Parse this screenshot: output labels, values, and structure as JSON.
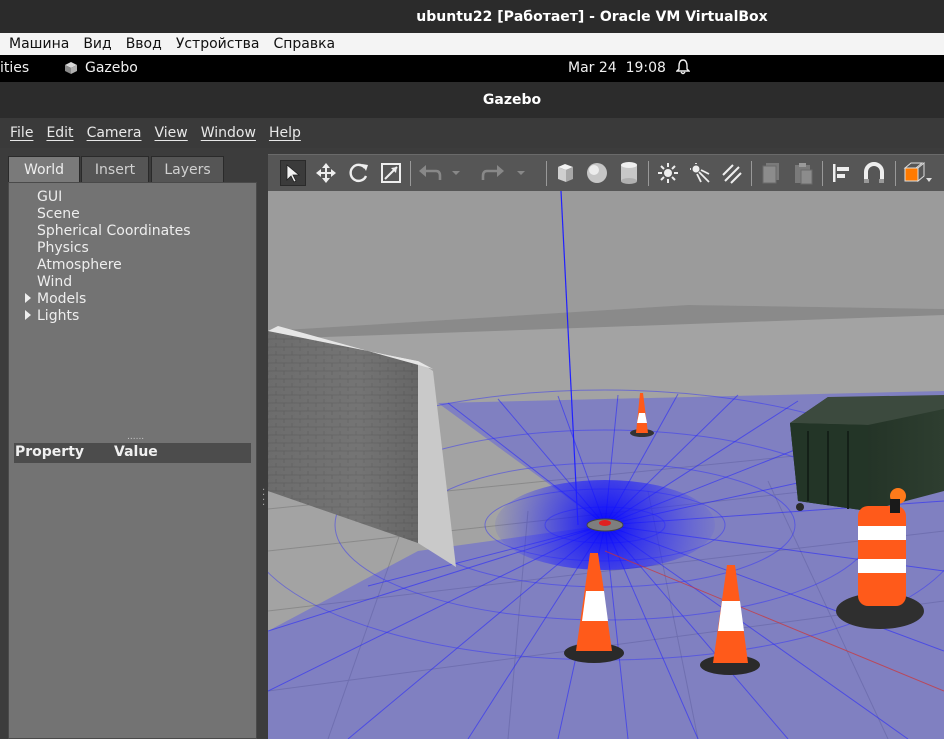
{
  "vbox": {
    "title": "ubuntu22 [Работает] - Oracle VM VirtualBox",
    "menu": [
      "Машина",
      "Вид",
      "Ввод",
      "Устройства",
      "Справка"
    ]
  },
  "ubuntu_bar": {
    "activities": "ities",
    "app_name": "Gazebo",
    "clock": "Mar 24  19:08",
    "bell_icon": "bell-icon"
  },
  "gazebo": {
    "window_title": "Gazebo",
    "menu": [
      "File",
      "Edit",
      "Camera",
      "View",
      "Window",
      "Help"
    ],
    "tabs": [
      "World",
      "Insert",
      "Layers"
    ],
    "active_tab": "World",
    "tree": [
      {
        "label": "GUI",
        "expandable": false
      },
      {
        "label": "Scene",
        "expandable": false
      },
      {
        "label": "Spherical Coordinates",
        "expandable": false
      },
      {
        "label": "Physics",
        "expandable": false
      },
      {
        "label": "Atmosphere",
        "expandable": false
      },
      {
        "label": "Wind",
        "expandable": false
      },
      {
        "label": "Models",
        "expandable": true
      },
      {
        "label": "Lights",
        "expandable": true
      }
    ],
    "splitter": "......",
    "property_header": {
      "property": "Property",
      "value": "Value"
    },
    "toolbar_icons": [
      "select-arrow-icon",
      "translate-icon",
      "rotate-icon",
      "scale-icon",
      "undo-icon",
      "undo-dropdown-icon",
      "redo-icon",
      "redo-dropdown-icon",
      "box-icon",
      "sphere-icon",
      "cylinder-icon",
      "point-light-icon",
      "spot-light-icon",
      "directional-light-icon",
      "copy-icon",
      "paste-icon",
      "align-icon",
      "snap-icon",
      "view-angle-icon"
    ]
  },
  "colors": {
    "panel_bg": "#737373",
    "toolbar_bg": "#565656",
    "laser": "#1e1eff",
    "cone_orange": "#ff5a1a",
    "sky": "#9a9a9a"
  }
}
